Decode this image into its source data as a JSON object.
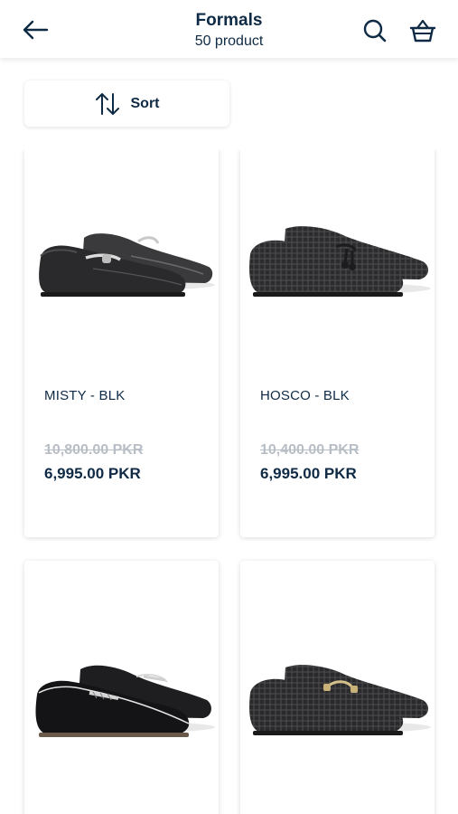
{
  "header": {
    "title": "Formals",
    "subtitle": "50 product",
    "icons": {
      "back": "arrow-left-icon",
      "search": "search-icon",
      "cart": "basket-icon"
    }
  },
  "toolbar": {
    "sort_label": "Sort",
    "sort_icon": "sort-arrows-icon"
  },
  "colors": {
    "text": "#0f2a44",
    "strike": "#b8bec6",
    "card_bg": "#ffffff"
  },
  "products": [
    {
      "name": "MISTY - BLK",
      "old_price": "10,800.00 PKR",
      "price": "6,995.00 PKR"
    },
    {
      "name": "HOSCO - BLK",
      "old_price": "10,400.00 PKR",
      "price": "6,995.00 PKR"
    },
    {
      "name": "",
      "old_price": "",
      "price": ""
    },
    {
      "name": "",
      "old_price": "",
      "price": ""
    }
  ]
}
